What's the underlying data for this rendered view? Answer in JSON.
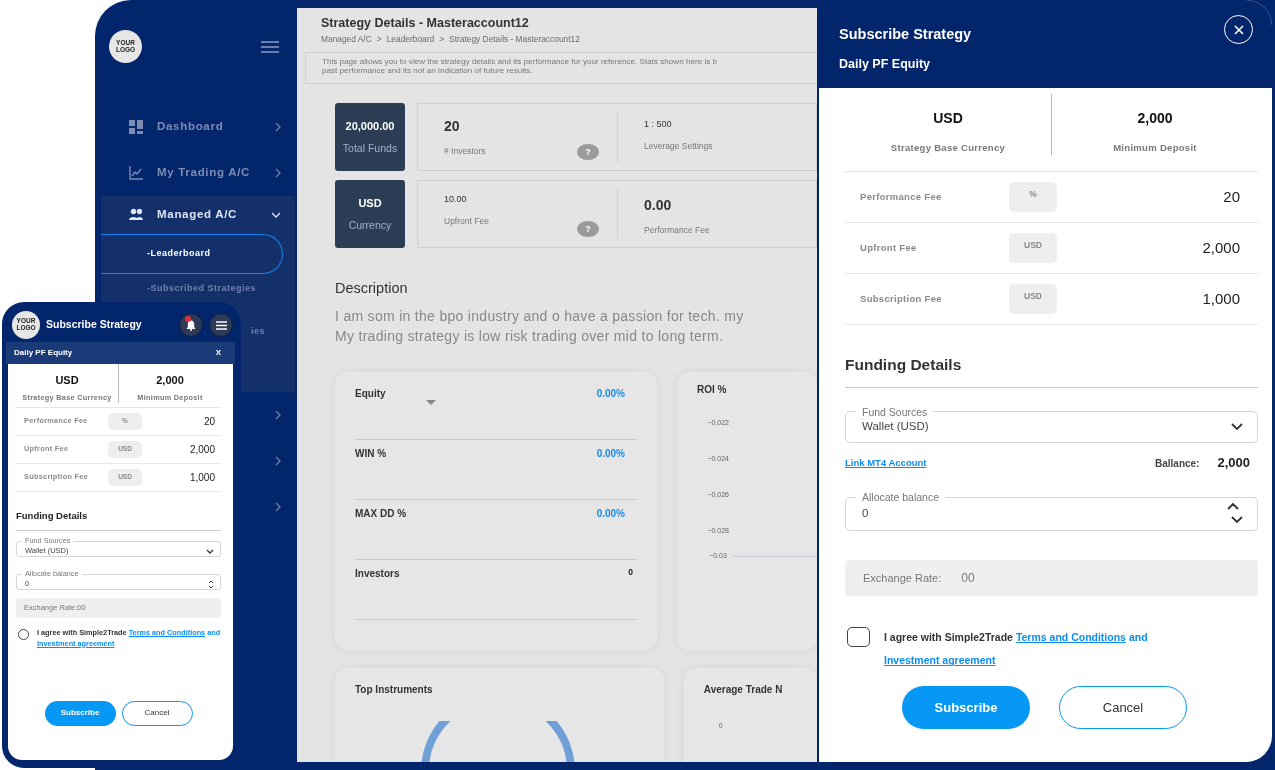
{
  "sidebar": {
    "logo": "YOUR LOGO",
    "items": [
      {
        "label": "Dashboard",
        "expanded": false
      },
      {
        "label": "My Trading A/C",
        "expanded": false
      },
      {
        "label": "Managed A/C",
        "expanded": true,
        "children": [
          {
            "label": "-Leaderboard",
            "selected": true
          },
          {
            "label": "-Subscribed Strategies",
            "selected": false
          },
          {
            "label": "ies",
            "selected": false
          }
        ]
      },
      {
        "expanded": false
      },
      {
        "expanded": false
      },
      {
        "expanded": false
      }
    ]
  },
  "page": {
    "title": "Strategy Details - Masteraccount12",
    "separator": ">",
    "breadcrumb": [
      "Managed A/C",
      "Leaderboard",
      "Strategy Details - Masteraccount12"
    ],
    "info": [
      "This page allows you to view the strategy details and its performance for your reference. Stats shown here is b",
      "past performance and its not an indication of future results."
    ]
  },
  "stats": [
    {
      "value": "20,000.00",
      "label": "Total Funds",
      "cells": [
        {
          "value": "20",
          "label": "# Investors",
          "help": "?",
          "emphasis": true
        },
        {
          "value": "1 : 500",
          "label": "Leverage Settings",
          "emphasis": false
        }
      ]
    },
    {
      "value": "USD",
      "label": "Currency",
      "cells": [
        {
          "value": "10.00",
          "label": "Upfront Fee",
          "help": "?",
          "emphasis": false
        },
        {
          "value": "0.00",
          "label": "Performance Fee",
          "emphasis": true
        }
      ]
    }
  ],
  "description": {
    "heading": "Description",
    "lines": [
      "I am som in the bpo industry and o have a passion for tech. my",
      "My trading strategy is low risk trading over mid to long term."
    ]
  },
  "metrics": [
    {
      "kind": "percent",
      "label": "Equity",
      "value": "0.00%",
      "dropdown": true
    },
    {
      "kind": "percent",
      "label": "WIN %",
      "value": "0.00%",
      "dropdown": false
    },
    {
      "kind": "percent",
      "label": "MAX DD %",
      "value": "0.00%",
      "dropdown": false
    },
    {
      "kind": "count",
      "label": "Investors",
      "value": "0",
      "dropdown": false
    }
  ],
  "roi": {
    "title": "ROI %",
    "ticks": [
      "−0.022",
      "−0.024",
      "−0.026",
      "−0.028",
      "−0.03"
    ]
  },
  "top_instruments": {
    "title": "Top Instruments"
  },
  "avg_trade": {
    "title": "Average Trade N",
    "tick": "0"
  },
  "panel": {
    "title": "Subscribe Strategy",
    "subtitle": "Daily PF Equity",
    "summary": [
      {
        "value": "USD",
        "label": "Strategy Base Currency"
      },
      {
        "value": "2,000",
        "label": "Minimum Deposit"
      }
    ],
    "fees": [
      {
        "label": "Performance Fee",
        "unit": "%",
        "value": "20"
      },
      {
        "label": "Upfront Fee",
        "unit": "USD",
        "value": "2,000"
      },
      {
        "label": "Subscription Fee",
        "unit": "USD",
        "value": "1,000"
      }
    ],
    "funding_heading": "Funding Details",
    "fund_sources": {
      "label": "Fund Sources",
      "value": "Wallet (USD)"
    },
    "link": "Link MT4 Account",
    "balance_label": "Ballance:",
    "balance": "2,000",
    "allocate": {
      "label": "Allocate balance",
      "value": "0"
    },
    "exchange": {
      "label": "Exchange Rate:",
      "value": "00"
    },
    "agree": {
      "checked": false,
      "text": "I agree with Simple2Trade",
      "terms": "Terms and Conditions",
      "and": "and",
      "investment": "Investment agreement"
    },
    "buttons": [
      "Subscribe",
      "Cancel"
    ]
  },
  "mobile": {
    "logo": "YOUR LOGO",
    "title": "Subscribe Strategy",
    "notification": true,
    "subtitle": "Daily PF Equity",
    "close": "X",
    "summary": [
      {
        "value": "USD",
        "label": "Strategy Base Currency"
      },
      {
        "value": "2,000",
        "label": "Minimum Deposit"
      }
    ],
    "fees": [
      {
        "label": "Performance Fee",
        "unit": "%",
        "value": "20"
      },
      {
        "label": "Upfront Fee",
        "unit": "USD",
        "value": "2,000"
      },
      {
        "label": "Subscription Fee",
        "unit": "USD",
        "value": "1,000"
      }
    ],
    "funding_heading": "Funding Details",
    "fund_sources": {
      "label": "Fund Sources",
      "value": "Wallet (USD)"
    },
    "allocate": {
      "label": "Allocate balance",
      "value": "0"
    },
    "exchange": "Exchange Rate:00",
    "agree": {
      "checked": false,
      "text": "I agree with Simple2Trade",
      "terms": "Terms and Conditions",
      "and": "and",
      "investment": "Investment agreement"
    },
    "buttons": [
      "Subscribe",
      "Cancel"
    ]
  }
}
